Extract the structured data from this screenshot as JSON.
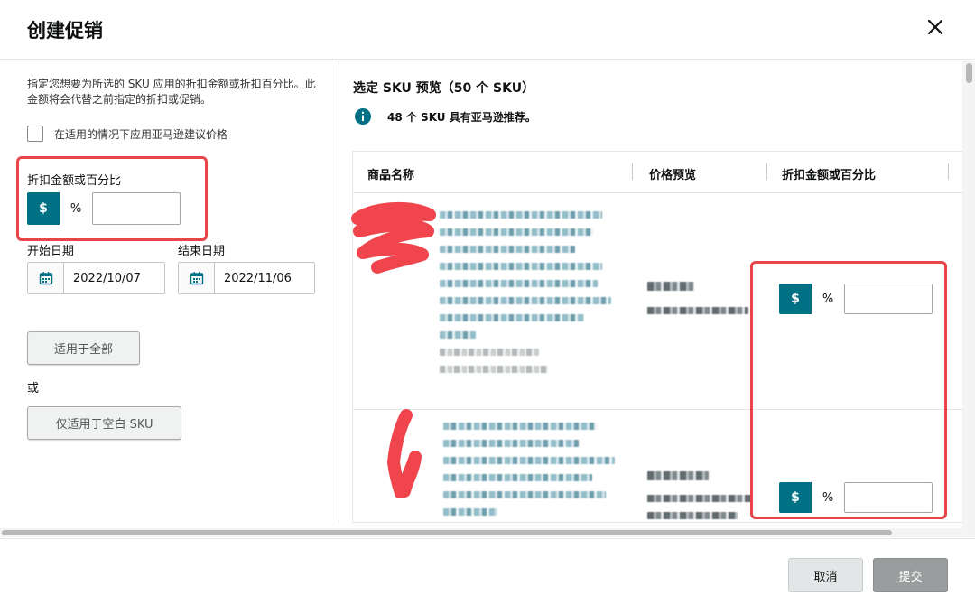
{
  "dialog": {
    "title": "创建促销",
    "close_icon": "close-icon"
  },
  "left_panel": {
    "description": "指定您想要为所选的 SKU 应用的折扣金额或折扣百分比。此金额将会代替之前指定的折扣或促销。",
    "suggest_checkbox_label": "在适用的情况下应用亚马逊建议价格",
    "discount_label": "折扣金额或百分比",
    "dollar_label": "$",
    "percent_label": "%",
    "discount_value": "",
    "start_date_label": "开始日期",
    "start_date_value": "2022/10/07",
    "end_date_label": "结束日期",
    "end_date_value": "2022/11/06",
    "apply_all_label": "适用于全部",
    "or_label": "或",
    "apply_blank_label": "仅适用于空白 SKU"
  },
  "right_panel": {
    "title": "选定 SKU 预览（50 个 SKU）",
    "info_text": "48 个 SKU 具有亚马逊推荐。",
    "columns": [
      "商品名称",
      "价格预览",
      "折扣金额或百分比"
    ],
    "rows": [
      {
        "dollar_label": "$",
        "percent_label": "%",
        "value": ""
      },
      {
        "dollar_label": "$",
        "percent_label": "%",
        "value": ""
      }
    ]
  },
  "footer": {
    "cancel_label": "取消",
    "submit_label": "提交"
  },
  "colors": {
    "accent": "#007185",
    "highlight_red": "#e8444a",
    "redaction_red": "#f0454d"
  }
}
